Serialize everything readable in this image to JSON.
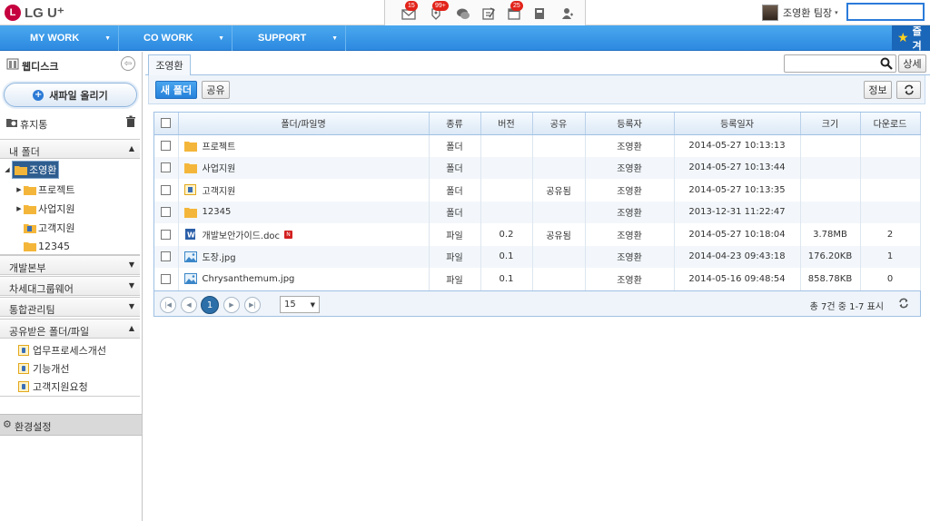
{
  "brand": {
    "logo_mark": "L",
    "logo_text": "LG U⁺"
  },
  "top_icons": [
    {
      "name": "mail-icon",
      "badge": "15"
    },
    {
      "name": "bell-icon",
      "badge": "99+"
    },
    {
      "name": "chat-icon",
      "badge": ""
    },
    {
      "name": "note-icon",
      "badge": ""
    },
    {
      "name": "calendar-icon",
      "badge": "25"
    },
    {
      "name": "notebook-icon",
      "badge": ""
    },
    {
      "name": "contact-icon",
      "badge": ""
    }
  ],
  "user": {
    "name": "조영환 팀장",
    "caret": "▾"
  },
  "nav": {
    "items": [
      "MY WORK",
      "CO WORK",
      "SUPPORT"
    ],
    "favorites": "즐겨"
  },
  "sidebar": {
    "title": "웹디스크",
    "upload": "새파일 올리기",
    "trash": "휴지통",
    "my_folder": "내 폴더",
    "tree": {
      "root": "조영환",
      "children": [
        "프로젝트",
        "사업지원",
        "고객지원",
        "12345"
      ]
    },
    "sections": [
      "개발본부",
      "차세대그룹웨어",
      "통합관리팀",
      "공유받은 폴더/파일"
    ],
    "shared_items": [
      "업무프로세스개선",
      "기능개선",
      "고객지원요청"
    ],
    "settings": "환경설정"
  },
  "main": {
    "tab": "조영환",
    "search_placeholder": "",
    "detail_button": "상세",
    "new_folder": "새 폴더",
    "share": "공유",
    "info": "정보",
    "columns": [
      "폴더/파일명",
      "종류",
      "버전",
      "공유",
      "등록자",
      "등록일자",
      "크기",
      "다운로드"
    ],
    "rows": [
      {
        "name": "프로젝트",
        "icon": "folder",
        "type": "폴더",
        "version": "",
        "share": "",
        "owner": "조영환",
        "date": "2014-05-27 10:13:13",
        "size": "",
        "downloads": ""
      },
      {
        "name": "사업지원",
        "icon": "folder",
        "type": "폴더",
        "version": "",
        "share": "",
        "owner": "조영환",
        "date": "2014-05-27 10:13:44",
        "size": "",
        "downloads": ""
      },
      {
        "name": "고객지원",
        "icon": "shared-folder",
        "type": "폴더",
        "version": "",
        "share": "공유됨",
        "owner": "조영환",
        "date": "2014-05-27 10:13:35",
        "size": "",
        "downloads": ""
      },
      {
        "name": "12345",
        "icon": "folder",
        "type": "폴더",
        "version": "",
        "share": "",
        "owner": "조영환",
        "date": "2013-12-31 11:22:47",
        "size": "",
        "downloads": ""
      },
      {
        "name": "개발보안가이드.doc",
        "icon": "word",
        "new": "N",
        "type": "파일",
        "version": "0.2",
        "share": "공유됨",
        "owner": "조영환",
        "date": "2014-05-27 10:18:04",
        "size": "3.78MB",
        "downloads": "2"
      },
      {
        "name": "도장.jpg",
        "icon": "image",
        "type": "파일",
        "version": "0.1",
        "share": "",
        "owner": "조영환",
        "date": "2014-04-23 09:43:18",
        "size": "176.20KB",
        "downloads": "1"
      },
      {
        "name": "Chrysanthemum.jpg",
        "icon": "image",
        "type": "파일",
        "version": "0.1",
        "share": "",
        "owner": "조영환",
        "date": "2014-05-16 09:48:54",
        "size": "858.78KB",
        "downloads": "0"
      }
    ],
    "pager": {
      "current": "1",
      "page_size": "15",
      "info": "총 7건 중 1-7 표시"
    }
  },
  "colors": {
    "accent": "#2c89e0",
    "brand": "#c5003e",
    "folder": "#f4b63a"
  }
}
